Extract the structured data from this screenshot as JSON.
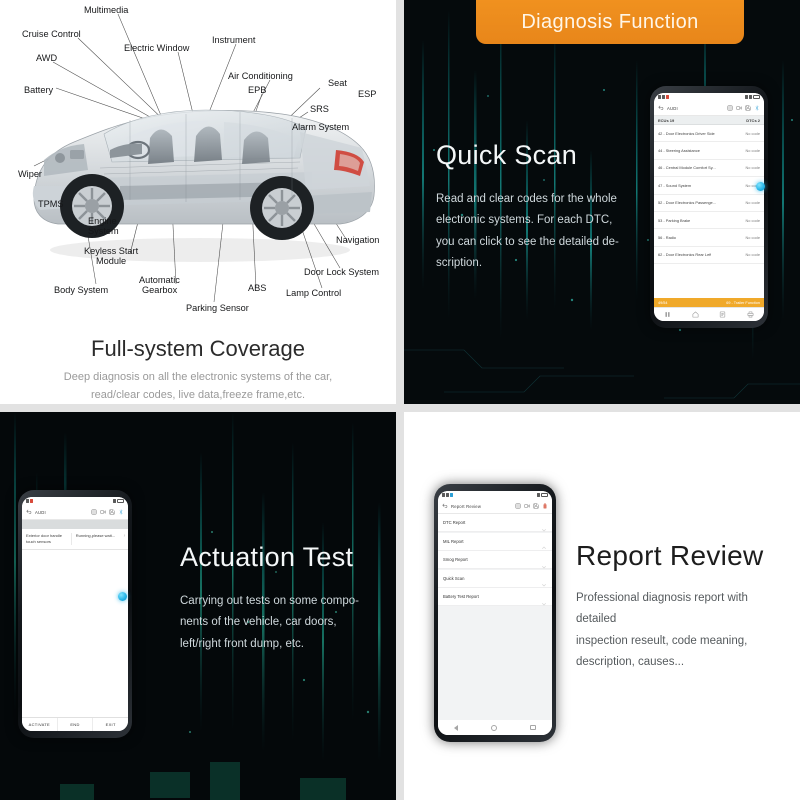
{
  "banner": {
    "label": "Diagnosis Function",
    "color": "#ED8B1A"
  },
  "panels": {
    "full_system": {
      "title": "Full-system Coverage",
      "description_line1": "Deep diagnosis on all the electronic systems of the car,",
      "description_line2": "read/clear codes, live data,freeze frame,etc.",
      "diagram_labels": [
        "Multimedia",
        "Cruise Control",
        "Electric Window",
        "Instrument",
        "AWD",
        "Air Conditioning",
        "EPB",
        "Seat",
        "ESP",
        "Battery",
        "SRS",
        "Alarm System",
        "Wiper",
        "TPMS",
        "Engine System",
        "Keyless Start Module",
        "Navigation",
        "Body System",
        "Automatic Gearbox",
        "Parking Sensor",
        "ABS",
        "Door Lock System",
        "Lamp Control"
      ]
    },
    "quick_scan": {
      "title": "Quick Scan",
      "description_line1": "Read and clear codes for the whole",
      "description_line2": "electronic systems. For each DTC,",
      "description_line3": "you can click to see the detailed de-",
      "description_line4": "scription.",
      "phone": {
        "appbar_title": "AUDI",
        "appbar_icons": [
          "screenshot-icon",
          "record-icon",
          "save-icon",
          "bluetooth-icon"
        ],
        "summary_left": "ECUs 19",
        "summary_right": "DTCs 2",
        "rows": [
          {
            "name": "42 - Door Electronics Driver Side",
            "value": "No code"
          },
          {
            "name": "44 - Steering Assistance",
            "value": "No code"
          },
          {
            "name": "46 - Central Module Comfort Sy...",
            "value": "No code"
          },
          {
            "name": "47 - Sound System",
            "value": "No code"
          },
          {
            "name": "52 - Door Electronics Passenge...",
            "value": "No code"
          },
          {
            "name": "53 - Parking Brake",
            "value": "No code"
          },
          {
            "name": "56 - Radio",
            "value": "No code"
          },
          {
            "name": "62 - Door Electronics Rear Left",
            "value": "No code"
          }
        ],
        "progress_left": "49/54",
        "progress_right": "69 - Trailer Function",
        "nav_icons": [
          "pause-icon",
          "home-icon",
          "report-icon",
          "print-icon"
        ]
      }
    },
    "actuation_test": {
      "title": "Actuation Test",
      "description_line1": "Carrying out tests on some compo-",
      "description_line2": "nents of the vehicle, car doors,",
      "description_line3": "left/right front dump, etc.",
      "phone": {
        "appbar_title": "AUDI",
        "appbar_icons": [
          "screenshot-icon",
          "record-icon",
          "save-icon",
          "bluetooth-icon"
        ],
        "test_name": "Exterior door handle touch sensors",
        "test_status": "Running,please wait...",
        "buttons": [
          "ACTIVATE",
          "END",
          "EXIT"
        ]
      }
    },
    "report_review": {
      "title": "Report Review",
      "description_line1": "Professional diagnosis report with detailed",
      "description_line2": "inspection reseult, code meaning,",
      "description_line3": "description, causes...",
      "phone": {
        "appbar_title": "Report Review",
        "appbar_icons": [
          "screenshot-icon",
          "record-icon",
          "save-icon",
          "battery-icon"
        ],
        "rows": [
          {
            "name": "DTC Report"
          },
          {
            "name": "MIL Report"
          },
          {
            "name": "Smog Report"
          },
          {
            "name": "Quick Scan"
          },
          {
            "name": "Battery Test Report"
          }
        ]
      }
    }
  }
}
